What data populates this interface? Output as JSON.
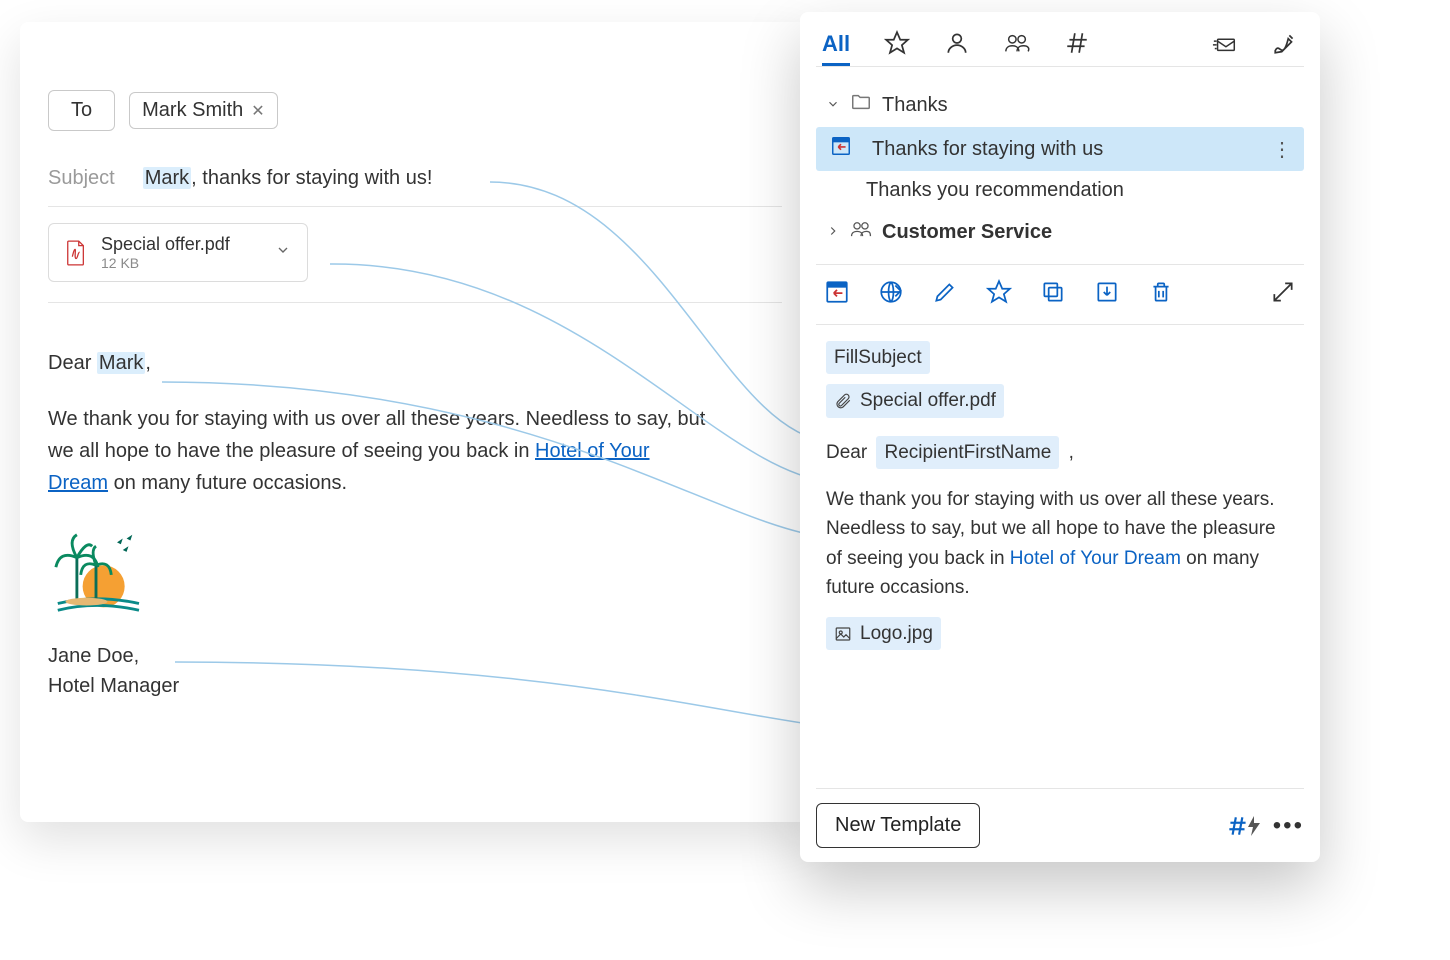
{
  "compose": {
    "to_label": "To",
    "recipient": "Mark Smith",
    "subject_label": "Subject",
    "subject_hl": "Mark",
    "subject_rest": ", thanks for staying with us!",
    "attachment": {
      "name": "Special offer.pdf",
      "size": "12 KB"
    },
    "greeting_pre": "Dear ",
    "greeting_hl": "Mark",
    "greeting_post": ",",
    "body_pre": "We thank you for staying with us over all these years. Needless to say, but we all hope to have the pleasure of seeing you back in ",
    "body_link": "Hotel of Your Dream",
    "body_post": " on many future occasions.",
    "signature_name": "Jane Doe,",
    "signature_title": "Hotel Manager"
  },
  "panel": {
    "tab_active": "All",
    "tree": {
      "folder1": "Thanks",
      "item_selected": "Thanks for staying with us",
      "item2": "Thanks you recommendation",
      "folder2": "Customer Service"
    },
    "preview": {
      "fill_subject": "FillSubject",
      "attachment": "Special offer.pdf",
      "dear": "Dear",
      "recipient_field": "RecipientFirstName",
      "comma": ",",
      "para_pre": "We thank you for staying with us over all these years. Needless to say, but we all hope to have the pleasure of seeing you back in ",
      "para_link": "Hotel of Your Dream",
      "para_post": " on many future occasions.",
      "logo_file": "Logo.jpg"
    },
    "new_template": "New Template"
  }
}
